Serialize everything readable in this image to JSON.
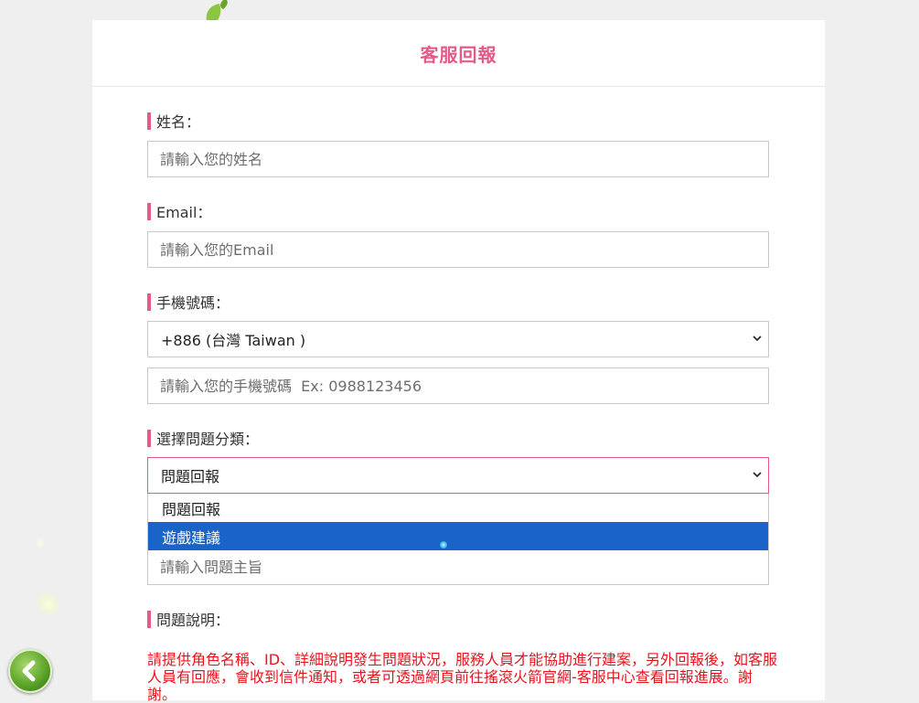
{
  "header": {
    "title": "客服回報"
  },
  "form": {
    "name": {
      "label": "姓名：",
      "placeholder": "請輸入您的姓名"
    },
    "email": {
      "label": "Email：",
      "placeholder": "請輸入您的Email"
    },
    "phone": {
      "label": "手機號碼：",
      "country_code": "+886 (台灣 Taiwan )",
      "placeholder": "請輸入您的手機號碼  Ex: 0988123456"
    },
    "category": {
      "label": "選擇問題分類：",
      "selected": "問題回報",
      "options": [
        "問題回報",
        "遊戲建議"
      ],
      "highlighted_index": 1
    },
    "subject": {
      "placeholder": "請輸入問題主旨"
    },
    "description": {
      "label": "問題說明：",
      "note": "請提供角色名稱、ID、詳細說明發生問題狀況，服務人員才能協助進行建案，另外回報後，如客服人員有回應，會收到信件通知，或者可透過網頁前往搖滾火箭官網-客服中心查看回報進展。謝謝。"
    }
  },
  "colors": {
    "accent": "#e65a8a",
    "highlight": "#1a64c9",
    "notice": "#e8141e"
  },
  "icons": {
    "back": "chevron-left-icon",
    "dropdown": "chevron-down-icon"
  }
}
